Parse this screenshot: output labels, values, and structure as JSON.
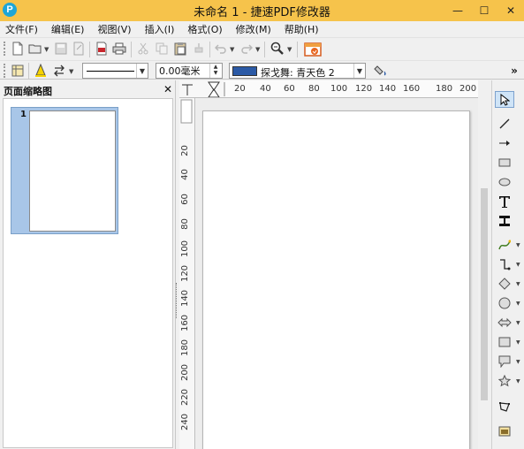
{
  "titlebar": {
    "logo_letter": "P",
    "title": "未命名 1 - 捷速PDF修改器",
    "buttons": [
      "—",
      "☐",
      "✕"
    ]
  },
  "menubar": {
    "items": [
      "文件(F)",
      "编辑(E)",
      "视图(V)",
      "插入(I)",
      "格式(O)",
      "修改(M)",
      "帮助(H)"
    ]
  },
  "toolbar1": {
    "icons": [
      "new-document-icon",
      "open-folder-icon",
      "save-icon",
      "export-icon",
      "export-pdf-icon",
      "print-icon",
      "cut-icon",
      "copy-icon",
      "paste-icon",
      "clone-format-icon",
      "undo-icon",
      "redo-icon",
      "zoom-icon",
      "pdf-convert-icon"
    ]
  },
  "toolbar2": {
    "line_width": "0.00毫米",
    "color_name": "探戈舞: 青天色 2",
    "color_hex": "#2b5aa6",
    "overflow": "»"
  },
  "panel": {
    "title": "页面缩略图",
    "close": "✕",
    "thumbnails": [
      {
        "number": "1"
      }
    ]
  },
  "ruler": {
    "horizontal": [
      "20",
      "40",
      "60",
      "80",
      "100",
      "120",
      "140",
      "160",
      "180",
      "200"
    ],
    "vertical": [
      "20",
      "40",
      "60",
      "80",
      "100",
      "120",
      "140",
      "160",
      "180",
      "200",
      "220",
      "240"
    ]
  },
  "drawbar": {
    "tools": [
      "select-icon",
      "line-icon",
      "arrow-line-icon",
      "rectangle-icon",
      "ellipse-icon",
      "text-icon",
      "vertical-text-icon",
      "curve-icon",
      "connector-icon",
      "basic-shape-icon",
      "symbol-shape-icon",
      "block-arrow-icon",
      "flowchart-icon",
      "callout-icon",
      "star-icon",
      "points-icon",
      "gallery-icon"
    ]
  },
  "colors": {
    "titlebar": "#f6c34b",
    "thumbnail_selected": "#a8c6e8",
    "accent": "#2b5aa6"
  }
}
